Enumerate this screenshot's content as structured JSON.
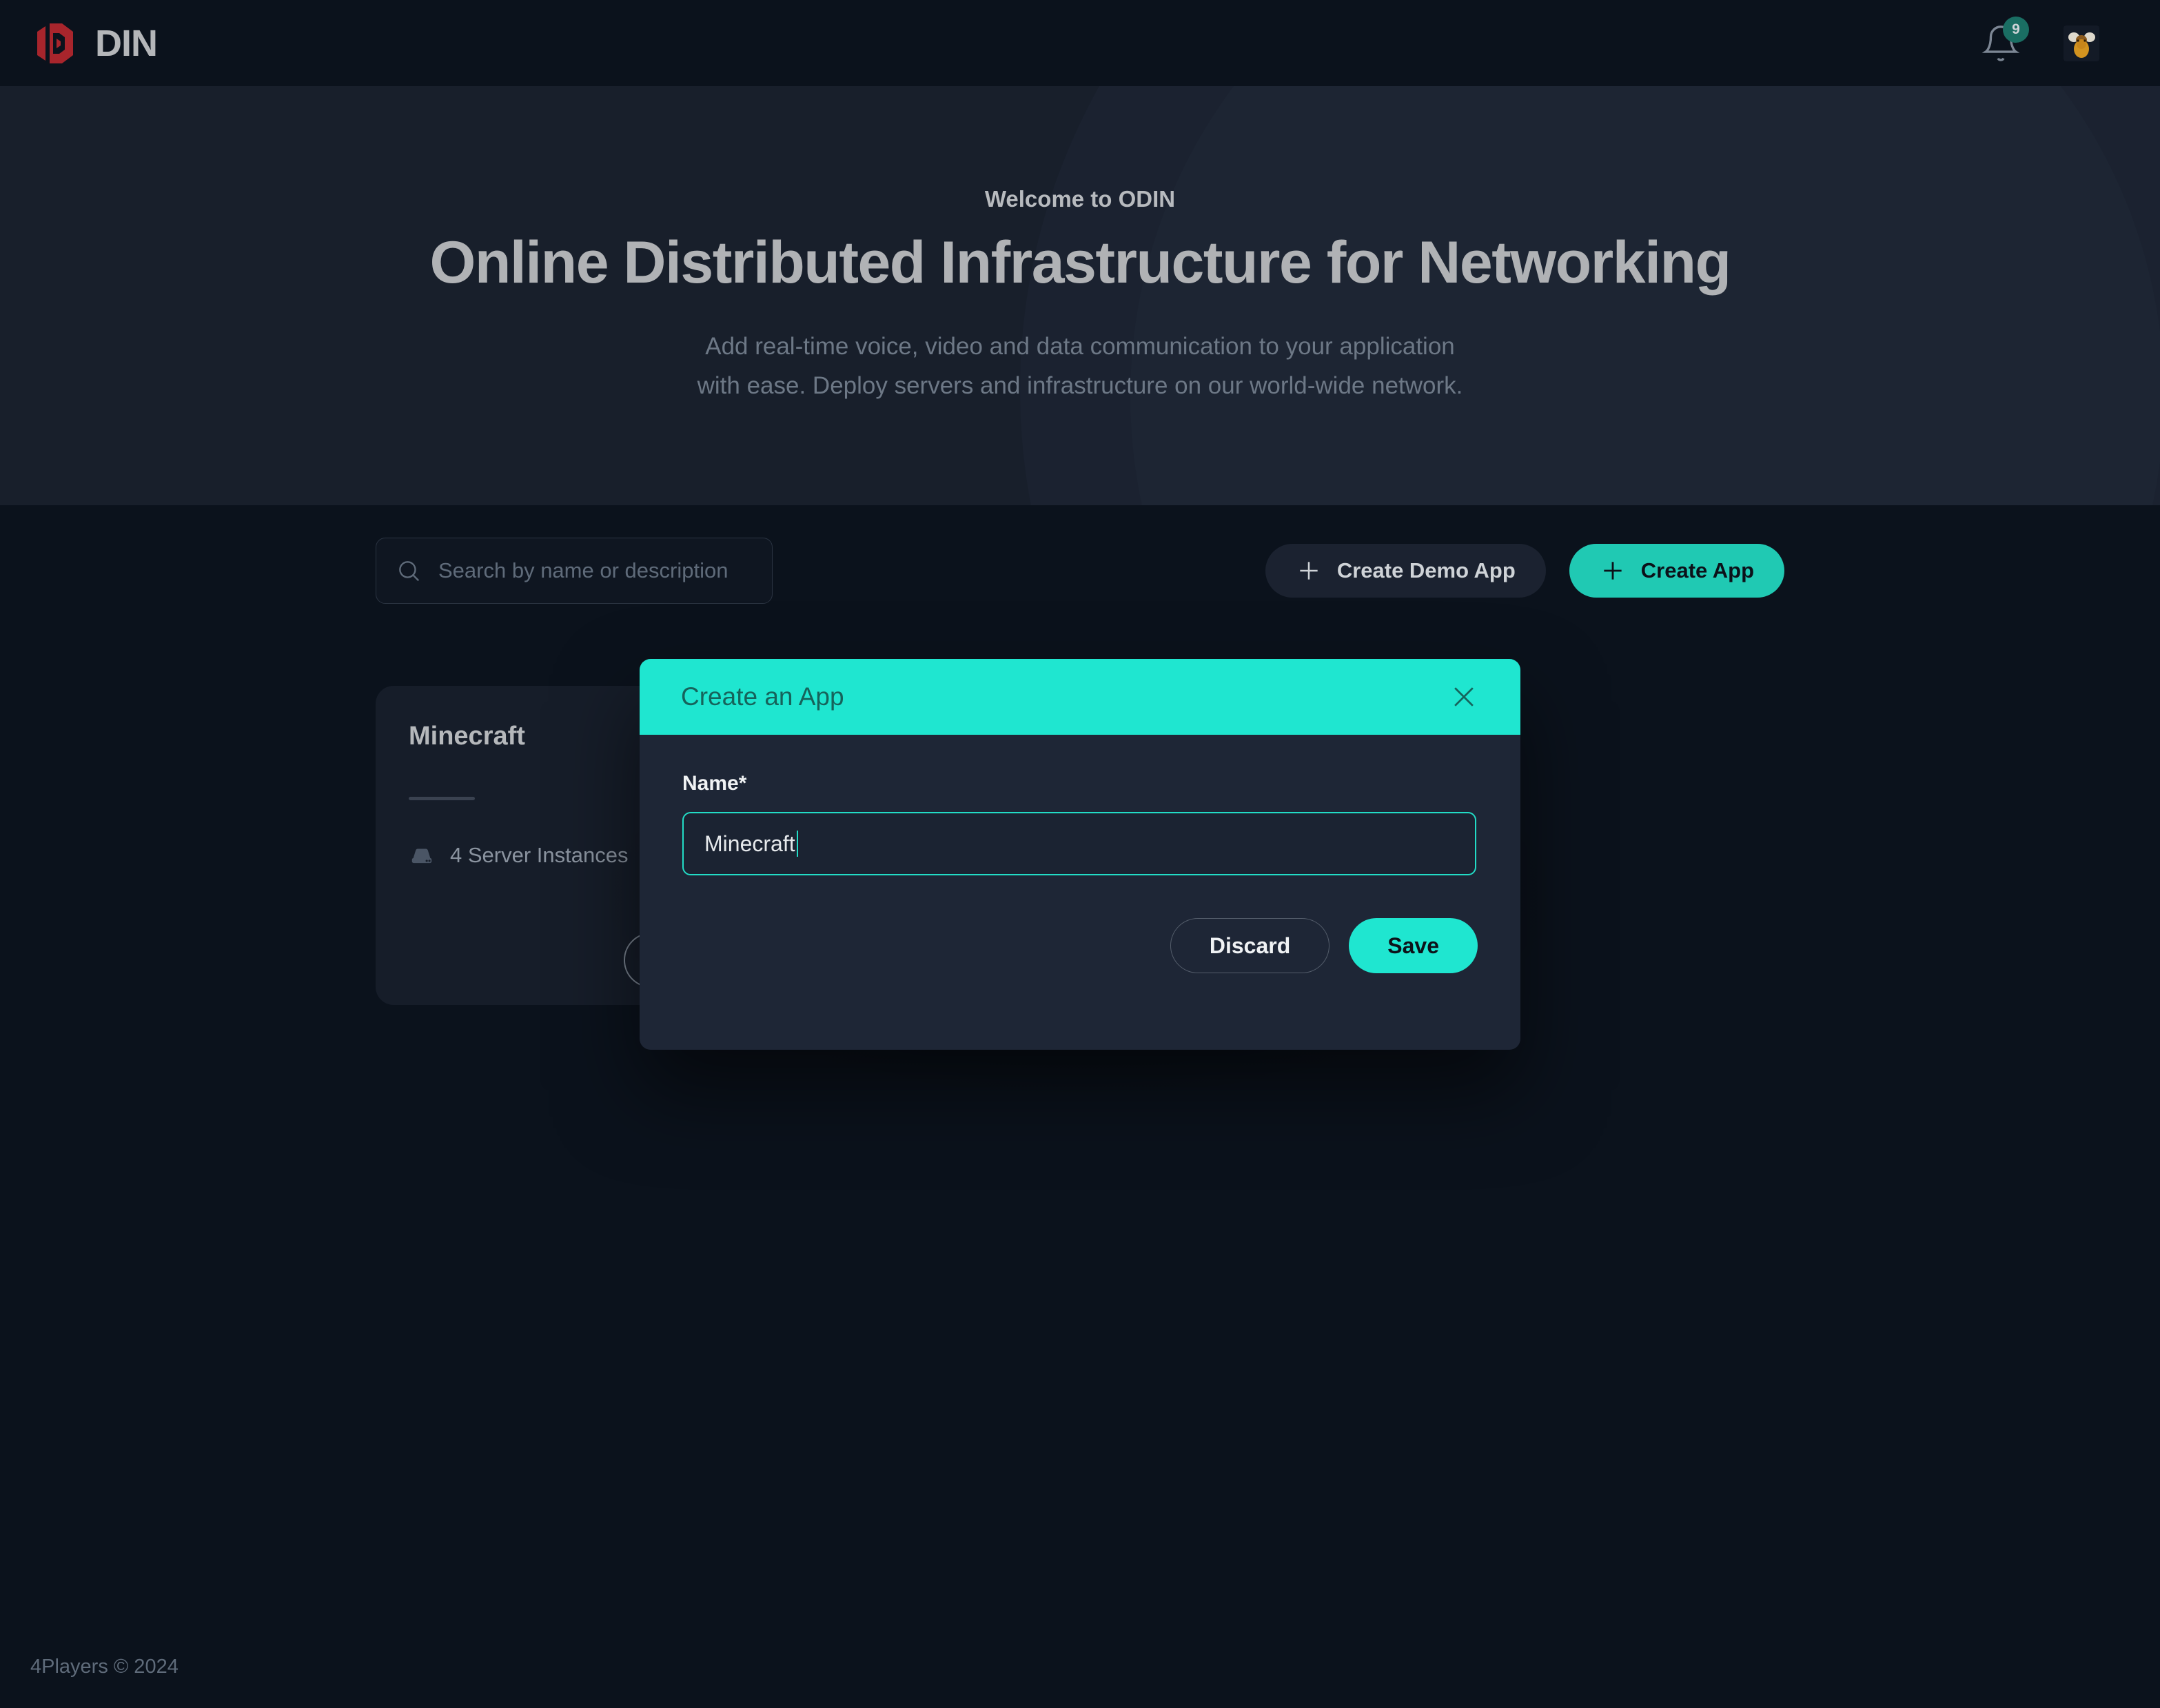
{
  "header": {
    "logo_text": "DIN",
    "logo_name": "odin-logo",
    "notification_count": "9",
    "bell_icon": "bell-icon",
    "avatar_icon": "moose-avatar"
  },
  "hero": {
    "kicker": "Welcome to ODIN",
    "title": "Online Distributed Infrastructure for Networking",
    "subtitle_line1": "Add real-time voice, video and data communication to your application",
    "subtitle_line2": "with ease. Deploy servers and infrastructure on our world-wide network."
  },
  "toolbar": {
    "search_placeholder": "Search by name or description",
    "search_value": "",
    "search_icon": "search-icon",
    "create_demo_label": "Create Demo App",
    "create_label": "Create App",
    "plus_icon": "plus-icon"
  },
  "app_cards": [
    {
      "title": "Minecraft",
      "instances_label": "4 Server Instances",
      "server_icon": "server-icon"
    }
  ],
  "modal": {
    "title": "Create an App",
    "close_icon": "close-icon",
    "field_label": "Name*",
    "field_value": "Minecraft",
    "field_placeholder": "",
    "discard_label": "Discard",
    "save_label": "Save"
  },
  "footer": {
    "copyright": "4Players © 2024"
  },
  "colors": {
    "accent_teal": "#1FE6D0",
    "accent_teal_dark": "#20C9B3",
    "logo_red": "#A8252C",
    "page_bg": "#0B121C",
    "hero_bg": "#181F2B",
    "card_bg": "#161D29",
    "modal_bg": "#1E2636",
    "badge_green": "#1A6E63"
  }
}
